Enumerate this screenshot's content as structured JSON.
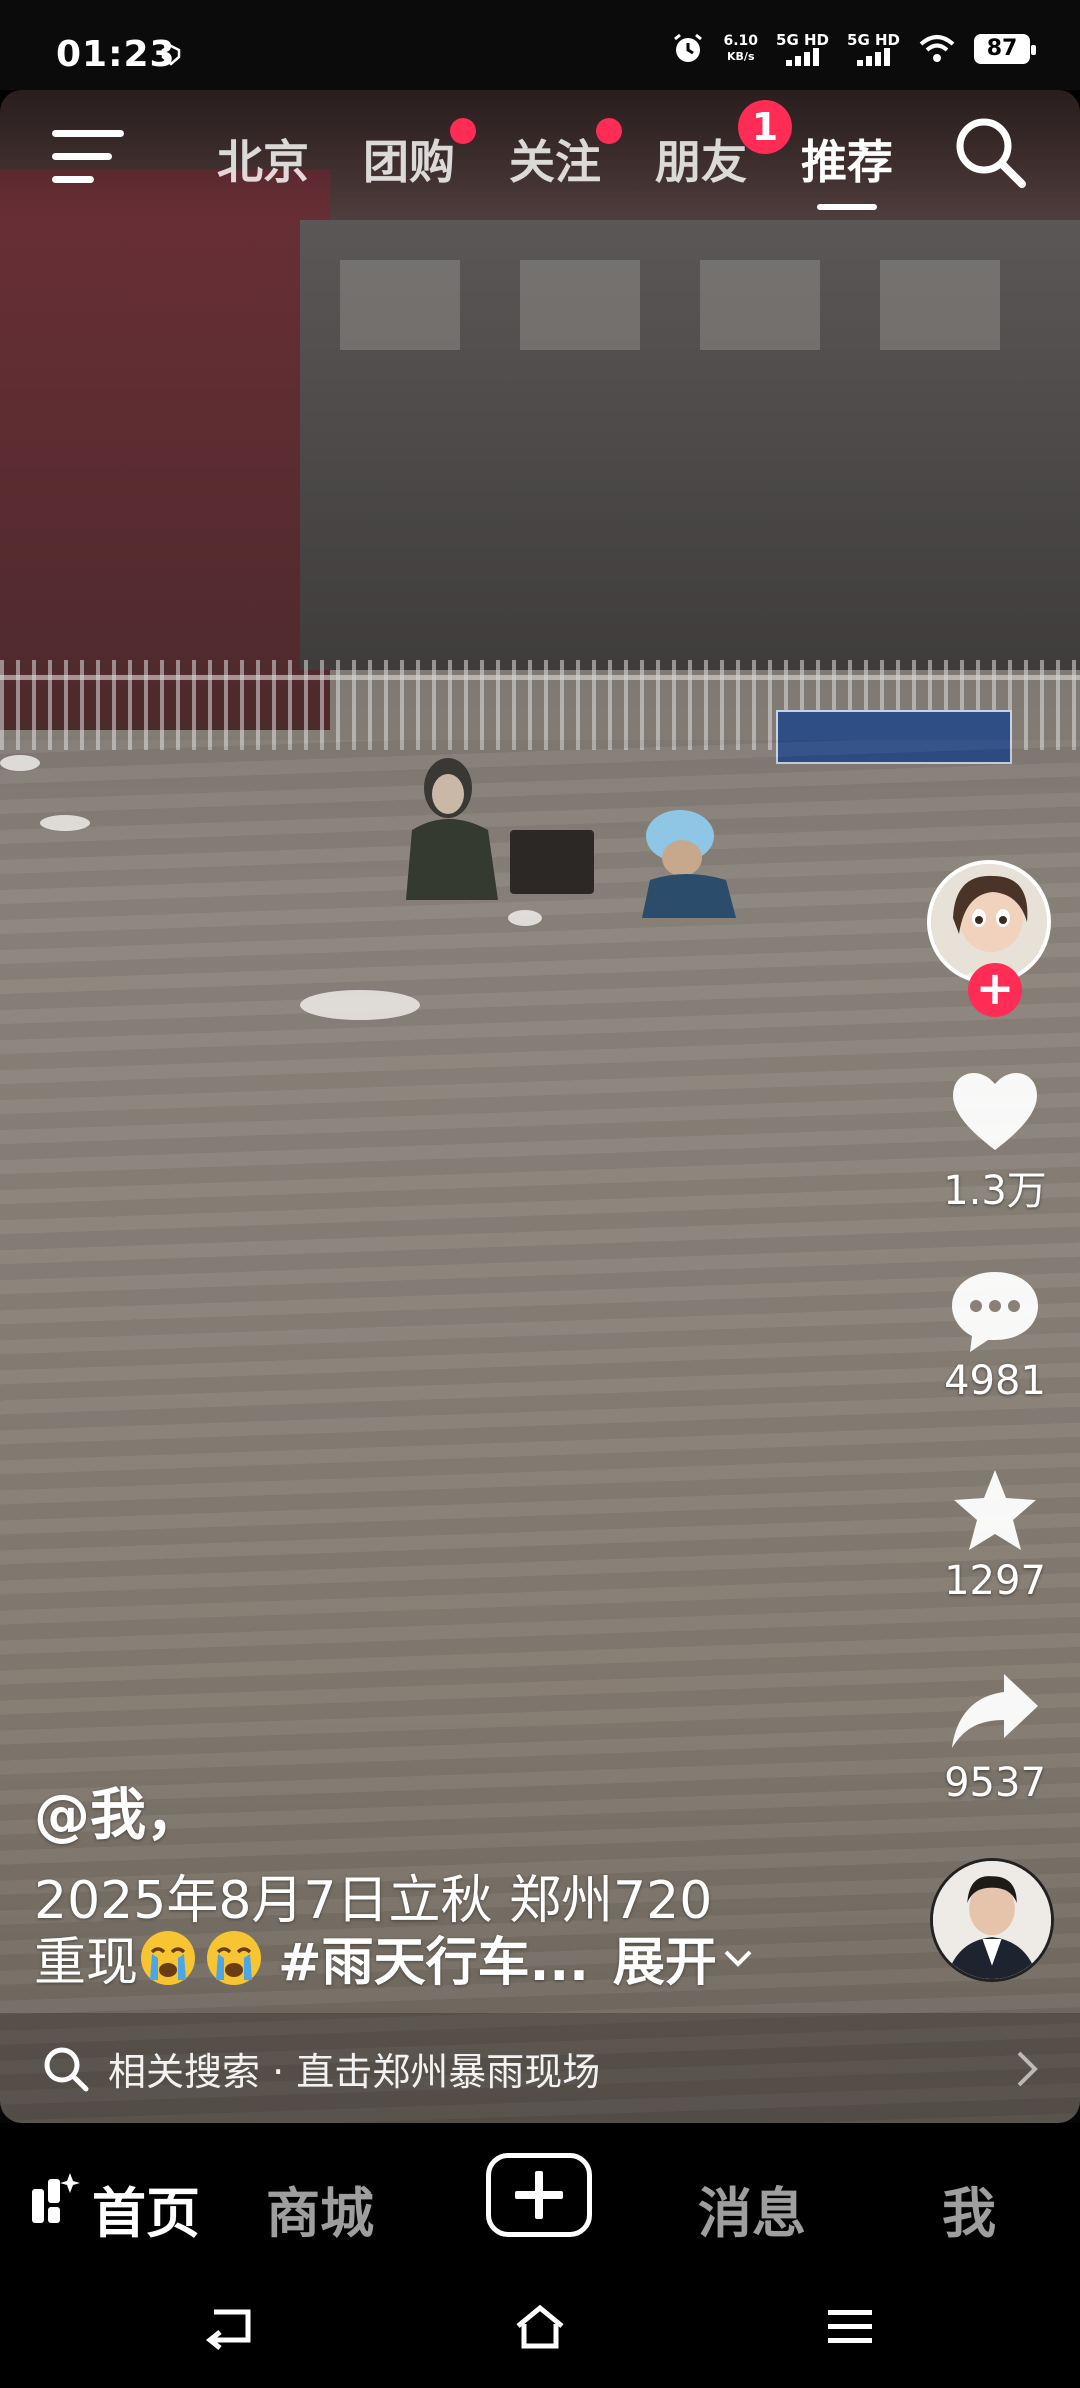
{
  "status_bar": {
    "time": "01:23",
    "net_speed_value": "6.10",
    "net_speed_unit": "KB/s",
    "sim1_label": "5G HD",
    "sim2_label": "5G HD",
    "battery": "87"
  },
  "top_nav": {
    "tabs": [
      {
        "label": "北京"
      },
      {
        "label": "团购"
      },
      {
        "label": "关注"
      },
      {
        "label": "朋友"
      },
      {
        "label": "推荐"
      }
    ],
    "friends_badge": "1",
    "active_tab": "推荐"
  },
  "actions": {
    "likes": "1.3万",
    "comments": "4981",
    "favorites": "1297",
    "shares": "9537"
  },
  "caption": {
    "author": "@我，",
    "line1": "2025年8月7日立秋 郑州720",
    "line2_prefix": "重现",
    "hashtag": "#雨天行车...",
    "expand": "展开"
  },
  "related_search": {
    "text": "相关搜索 · 直击郑州暴雨现场"
  },
  "tab_bar": {
    "home": "首页",
    "mall": "商城",
    "messages": "消息",
    "me": "我"
  },
  "colors": {
    "accent": "#ff2c55",
    "background": "#000000"
  }
}
